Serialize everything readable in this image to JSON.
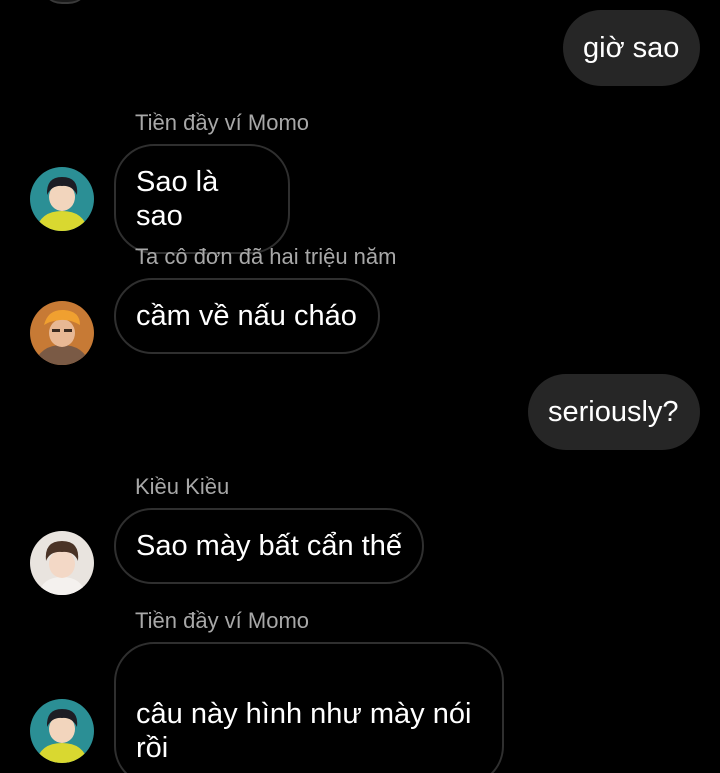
{
  "messages": [
    {
      "direction": "outgoing",
      "text": "giờ sao"
    },
    {
      "direction": "incoming",
      "sender": "Tiền đầy ví Momo",
      "text": "Sao là sao",
      "avatar": "avatar-green-jacket"
    },
    {
      "direction": "incoming",
      "sender": "Ta cô đơn đã hai triệu năm",
      "text": "cầm về nấu cháo",
      "avatar": "avatar-orange-cap"
    },
    {
      "direction": "outgoing",
      "text": "seriously?"
    },
    {
      "direction": "incoming",
      "sender": "Kiều Kiều",
      "text": "Sao mày bất cẩn thế",
      "avatar": "avatar-light"
    },
    {
      "direction": "incoming",
      "sender": "Tiền đầy ví Momo",
      "text": "câu này hình như mày nói\nrồi",
      "avatar": "avatar-green-jacket"
    }
  ],
  "colors": {
    "background": "#000000",
    "outgoing_bubble": "#262626",
    "incoming_border": "#2f2f2f",
    "sender_name": "#a8a8a8",
    "text": "#ffffff"
  }
}
